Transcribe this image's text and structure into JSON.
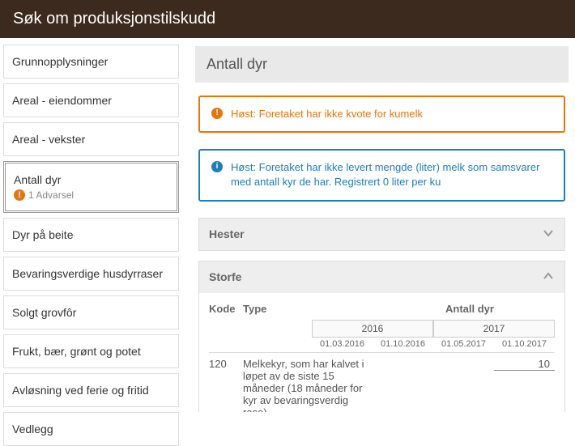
{
  "header": {
    "title": "Søk om produksjonstilskudd"
  },
  "sidebar": {
    "items": [
      {
        "label": "Grunnopplysninger"
      },
      {
        "label": "Areal - eiendommer"
      },
      {
        "label": "Areal - vekster"
      },
      {
        "label": "Antall dyr",
        "warning": "1 Advarsel"
      },
      {
        "label": "Dyr på beite"
      },
      {
        "label": "Bevaringsverdige husdyrraser"
      },
      {
        "label": "Solgt grovfôr"
      },
      {
        "label": "Frukt, bær, grønt og potet"
      },
      {
        "label": "Avløsning ved ferie og fritid"
      },
      {
        "label": "Vedlegg"
      }
    ]
  },
  "main": {
    "title": "Antall dyr",
    "alerts": [
      {
        "kind": "orange",
        "text": "Høst: Foretaket har ikke kvote for kumelk"
      },
      {
        "kind": "blue",
        "text": "Høst: Foretaket har ikke levert mengde (liter) melk som samsvarer med antall kyr de har. Registrert 0 liter per ku"
      }
    ],
    "panels": {
      "hester": {
        "title": "Hester"
      },
      "storfe": {
        "title": "Storfe",
        "columns": {
          "kode": "Kode",
          "type": "Type",
          "antall": "Antall dyr"
        },
        "years": [
          "2016",
          "2017"
        ],
        "dates": [
          "01.03.2016",
          "01.10.2016",
          "01.05.2017",
          "01.10.2017"
        ],
        "row": {
          "kode": "120",
          "type": "Melkekyr, som har kalvet i løpet av de siste 15 måneder (18 måneder for kyr av bevaringsverdig rase)",
          "value": "10"
        }
      }
    }
  }
}
